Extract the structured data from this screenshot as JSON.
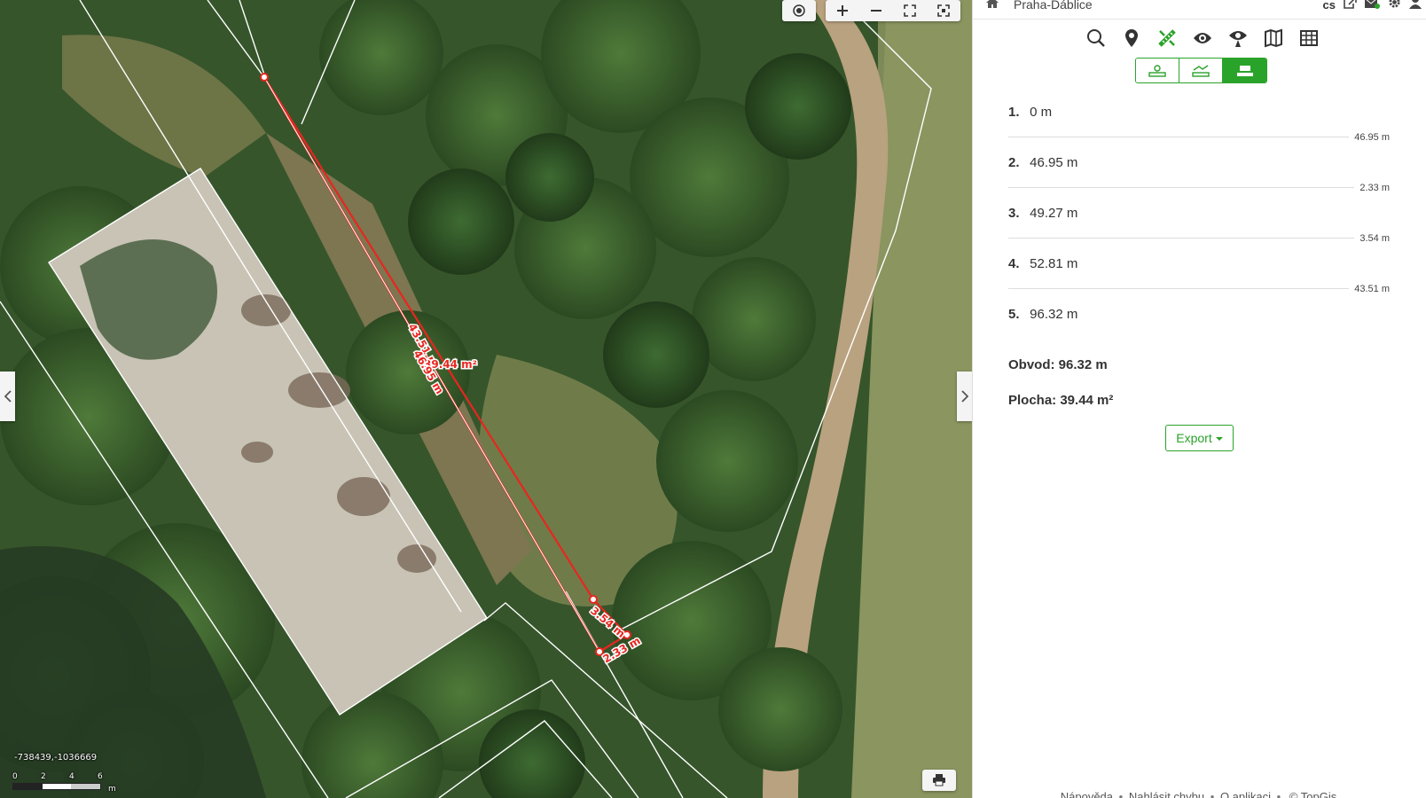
{
  "header": {
    "place": "Praha-Ďáblice",
    "lang": "cs"
  },
  "map": {
    "coords": "-738439,-1036669",
    "scale": {
      "ticks": [
        "0",
        "2",
        "4",
        "6"
      ],
      "unit": "m"
    },
    "labels": {
      "seg1": "43.51 m",
      "area": "39.44 m²",
      "seg2": "46.95 m",
      "seg3": "3.54 m",
      "seg4": "2.33 m"
    }
  },
  "toolbar": {
    "icons": [
      "search-icon",
      "location-icon",
      "measure-icon",
      "eye-icon",
      "eye-marker-icon",
      "map-book-icon",
      "table-icon"
    ],
    "modes": [
      "measure-point-mode",
      "measure-line-mode",
      "measure-area-mode"
    ],
    "active_mode": 2
  },
  "measure": {
    "points": [
      {
        "num": "1.",
        "value": "0 m",
        "segment": "46.95 m"
      },
      {
        "num": "2.",
        "value": "46.95 m",
        "segment": "2.33 m"
      },
      {
        "num": "3.",
        "value": "49.27 m",
        "segment": "3.54 m"
      },
      {
        "num": "4.",
        "value": "52.81 m",
        "segment": "43.51 m"
      },
      {
        "num": "5.",
        "value": "96.32 m",
        "segment": ""
      }
    ],
    "perimeter": "Obvod: 96.32 m",
    "area": "Plocha: 39.44 m²",
    "export_label": "Export"
  },
  "footer": {
    "help": "Nápověda",
    "report": "Nahlásit chybu",
    "about": "O aplikaci",
    "copyright": "© TopGis"
  },
  "colors": {
    "accent": "#2aa32a",
    "measure": "#e8261f"
  }
}
